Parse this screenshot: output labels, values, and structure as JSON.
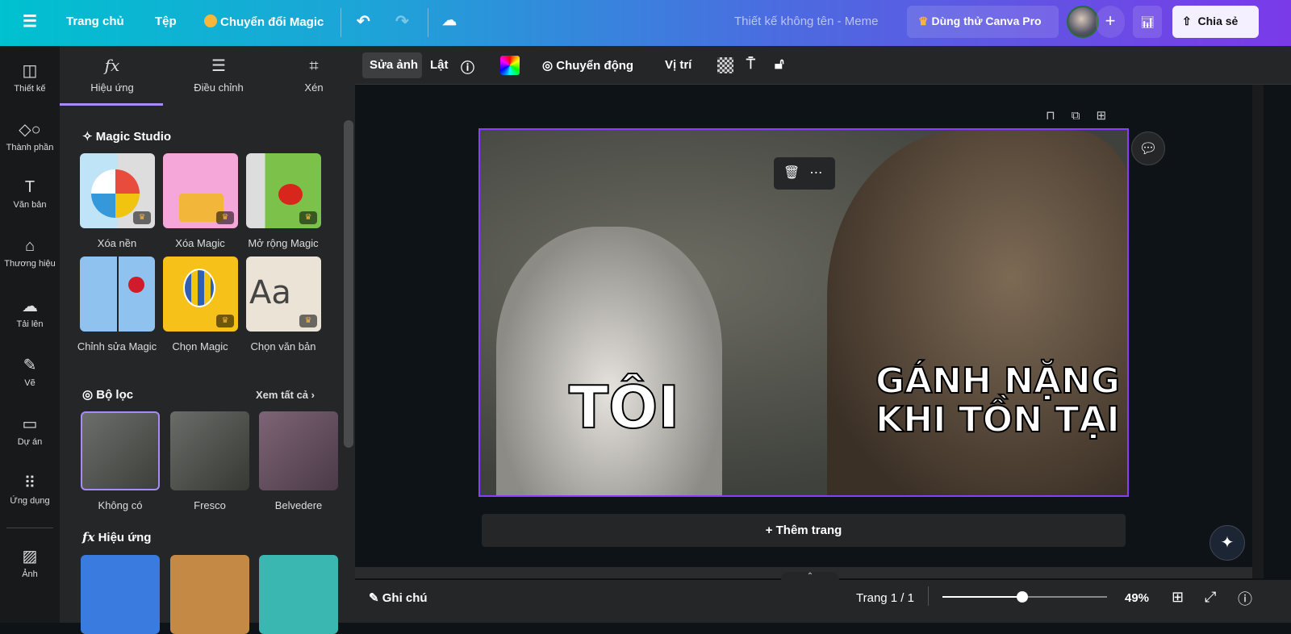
{
  "topbar": {
    "menu_icon": "hamburger-icon",
    "home": "Trang chủ",
    "file": "Tệp",
    "magic_switch": "Chuyển đổi Magic",
    "title": "Thiết kế không tên - Meme",
    "try_pro": "Dùng thử Canva Pro",
    "share": "Chia sẻ"
  },
  "rail": [
    {
      "label": "Thiết kế",
      "icon": "layout-icon"
    },
    {
      "label": "Thành phần",
      "icon": "elements-icon"
    },
    {
      "label": "Văn bản",
      "icon": "text-icon"
    },
    {
      "label": "Thương hiệu",
      "icon": "brand-icon"
    },
    {
      "label": "Tải lên",
      "icon": "upload-icon"
    },
    {
      "label": "Vẽ",
      "icon": "draw-icon"
    },
    {
      "label": "Dự án",
      "icon": "folder-icon"
    },
    {
      "label": "Ứng dụng",
      "icon": "apps-icon"
    },
    {
      "label": "Ảnh",
      "icon": "photo-icon"
    }
  ],
  "panel": {
    "tabs": [
      "Hiệu ứng",
      "Điều chỉnh",
      "Xén"
    ],
    "magic_studio": "Magic Studio",
    "magic_tools": [
      "Xóa nền",
      "Xóa Magic",
      "Mở rộng Magic",
      "Chỉnh sửa Magic",
      "Chọn Magic",
      "Chọn văn bản"
    ],
    "filters_title": "Bộ lọc",
    "see_all": "Xem tất cả",
    "filters": [
      "Không có",
      "Fresco",
      "Belvedere"
    ],
    "effects_title": "Hiệu ứng"
  },
  "toolbar": {
    "edit_photo": "Sửa ảnh",
    "flip": "Lật",
    "animate": "Chuyển động",
    "position": "Vị trí"
  },
  "canvas": {
    "text_left": "TÔI",
    "text_right_1": "GÁNH NẶNG",
    "text_right_2": "KHI TỒN TẠI",
    "add_page": "+ Thêm trang"
  },
  "bottom": {
    "notes": "Ghi chú",
    "page": "Trang 1 / 1",
    "zoom": "49%",
    "zoom_value": 49
  },
  "colors": {
    "accent": "#8b3dff"
  }
}
